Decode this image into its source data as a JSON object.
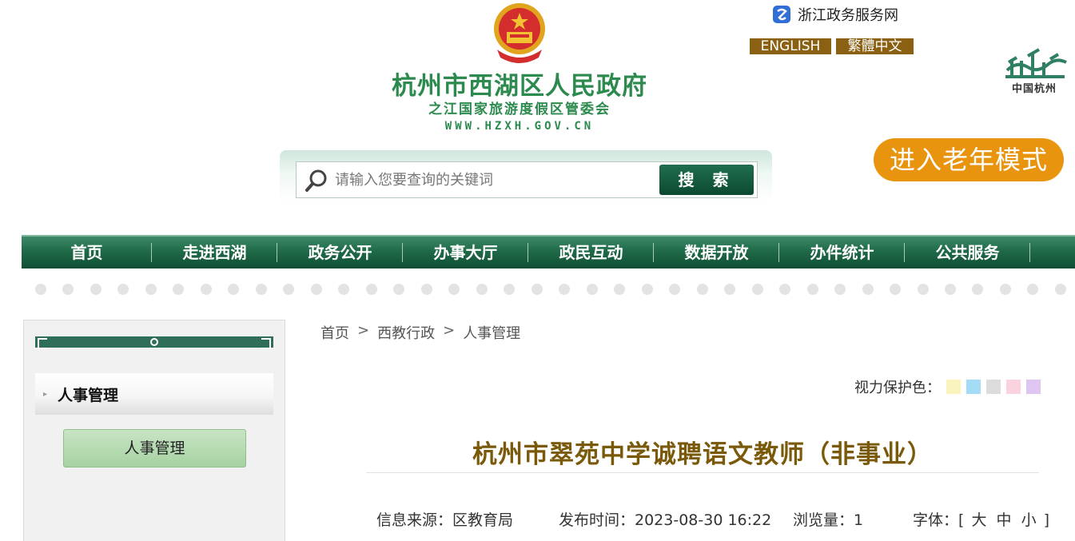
{
  "header": {
    "site_title": "杭州市西湖区人民政府",
    "site_subtitle": "之江国家旅游度假区管委会",
    "site_url": "WWW.HZXH.GOV.CN",
    "zj_service_label": "浙江政务服务网",
    "lang_english": "ENGLISH",
    "lang_traditional": "繁體中文",
    "hz_logo_text": "中国杭州",
    "elder_mode_label": "进入老年模式"
  },
  "search": {
    "placeholder": "请输入您要查询的关键词",
    "button_label": "搜 索"
  },
  "nav": {
    "items": [
      "首页",
      "走进西湖",
      "政务公开",
      "办事大厅",
      "政民互动",
      "数据开放",
      "办件统计",
      "公共服务"
    ]
  },
  "sidebar": {
    "heading": "人事管理",
    "items": [
      "人事管理"
    ]
  },
  "breadcrumb": {
    "items": [
      "首页",
      "西教行政",
      "人事管理"
    ],
    "separator": ">"
  },
  "eye_care": {
    "label": "视力保护色：",
    "colors": [
      "#fbf3bd",
      "#a5dcf5",
      "#dcdcdc",
      "#fbd3df",
      "#dfc5f2"
    ]
  },
  "article": {
    "title": "杭州市翠苑中学诚聘语文教师（非事业）",
    "source_label": "信息来源：区教育局",
    "publish_label": "发布时间：2023-08-30 16:22",
    "views_label": "浏览量：1",
    "font_label": "字体：[",
    "font_large": "大",
    "font_medium": "中",
    "font_small": "小",
    "font_close": "]"
  }
}
